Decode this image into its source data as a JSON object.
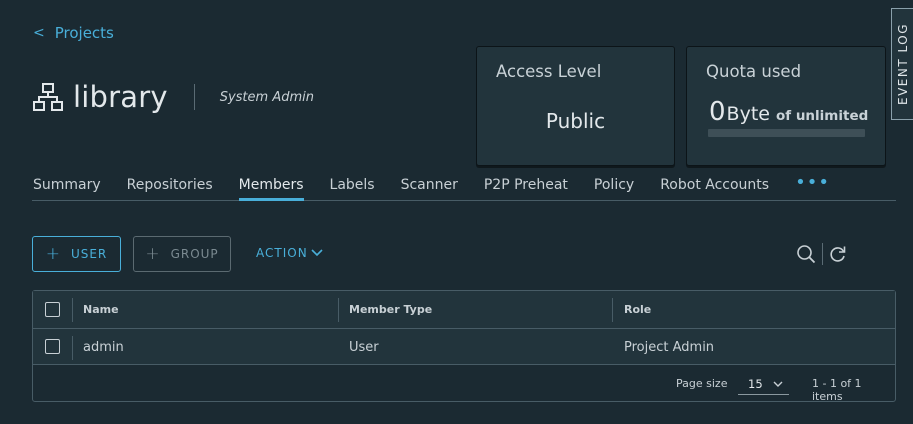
{
  "breadcrumb": {
    "back_chevron": "<",
    "label": "Projects"
  },
  "project": {
    "name": "library",
    "role": "System Admin",
    "icon": "project-icon"
  },
  "cards": {
    "access": {
      "title": "Access Level",
      "value": "Public"
    },
    "quota": {
      "title": "Quota used",
      "number": "0",
      "unit": "Byte",
      "suffix": "of unlimited",
      "used_fraction": 0
    }
  },
  "event_log": {
    "label": "EVENT LOG"
  },
  "tabs": [
    {
      "label": "Summary",
      "active": false
    },
    {
      "label": "Repositories",
      "active": false
    },
    {
      "label": "Members",
      "active": true
    },
    {
      "label": "Labels",
      "active": false
    },
    {
      "label": "Scanner",
      "active": false
    },
    {
      "label": "P2P Preheat",
      "active": false
    },
    {
      "label": "Policy",
      "active": false
    },
    {
      "label": "Robot Accounts",
      "active": false
    }
  ],
  "tabs_more": "•••",
  "toolbar": {
    "add_user_label": "USER",
    "add_group_label": "GROUP",
    "action_label": "ACTION",
    "plus": "+"
  },
  "table": {
    "columns": [
      "Name",
      "Member Type",
      "Role"
    ],
    "rows": [
      {
        "name": "admin",
        "member_type": "User",
        "role": "Project Admin"
      }
    ]
  },
  "pagination": {
    "page_size_label": "Page size",
    "page_size": "15",
    "items_text": "1 - 1 of 1 items"
  },
  "colors": {
    "accent": "#49afd9",
    "background": "#1b2a32",
    "card": "#22343c"
  }
}
